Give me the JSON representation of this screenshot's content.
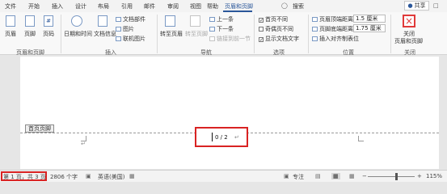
{
  "tabs": [
    "文件",
    "开始",
    "插入",
    "设计",
    "布局",
    "引用",
    "邮件",
    "审阅",
    "视图",
    "帮助",
    "页眉和页脚"
  ],
  "active_tab": "页眉和页脚",
  "search": {
    "label": "搜索",
    "icon": "lightbulb-icon"
  },
  "share": {
    "label": "共享",
    "icon": "person-icon"
  },
  "ribbon": {
    "hf": {
      "header": "页眉",
      "footer": "页脚",
      "page_number": "页码",
      "group": "页眉和页脚"
    },
    "insert": {
      "datetime": "日期和时间",
      "docinfo": "文档信息",
      "docparts": "文档部件",
      "picture": "图片",
      "online_picture": "联机图片",
      "group": "插入"
    },
    "nav": {
      "goto_header": "转至页眉",
      "goto_footer": "转至页脚",
      "prev": "上一条",
      "next": "下一条",
      "link_prev": "链接到前一节",
      "group": "导航"
    },
    "options": {
      "diff_first": "首页不同",
      "diff_odd_even": "奇偶页不同",
      "show_text": "显示文档文字",
      "group": "选项"
    },
    "position": {
      "header_top": "页眉顶端距离:",
      "header_top_value": "1.5 厘米",
      "footer_bottom": "页脚底端距离:",
      "footer_bottom_value": "1.75 厘米",
      "insert_align_tab": "插入对齐制表位",
      "group": "位置"
    },
    "close": {
      "label": "关闭\n页眉和页脚",
      "label1": "关闭",
      "label2": "页眉和页脚",
      "group": "关闭"
    }
  },
  "document": {
    "header_tag": "首页页脚",
    "page_number_text": "0 / 2",
    "para_mark": "↵"
  },
  "status": {
    "page_info": "第 1 页，共 3 页",
    "word_count": "2806 个字",
    "language": "英语(美国)",
    "focus": "专注",
    "zoom": "115%",
    "zoom_minus": "−",
    "zoom_plus": "+"
  },
  "colors": {
    "accent": "#2b579a",
    "highlight": "#d92323",
    "close_icon": "#e03a3a"
  }
}
